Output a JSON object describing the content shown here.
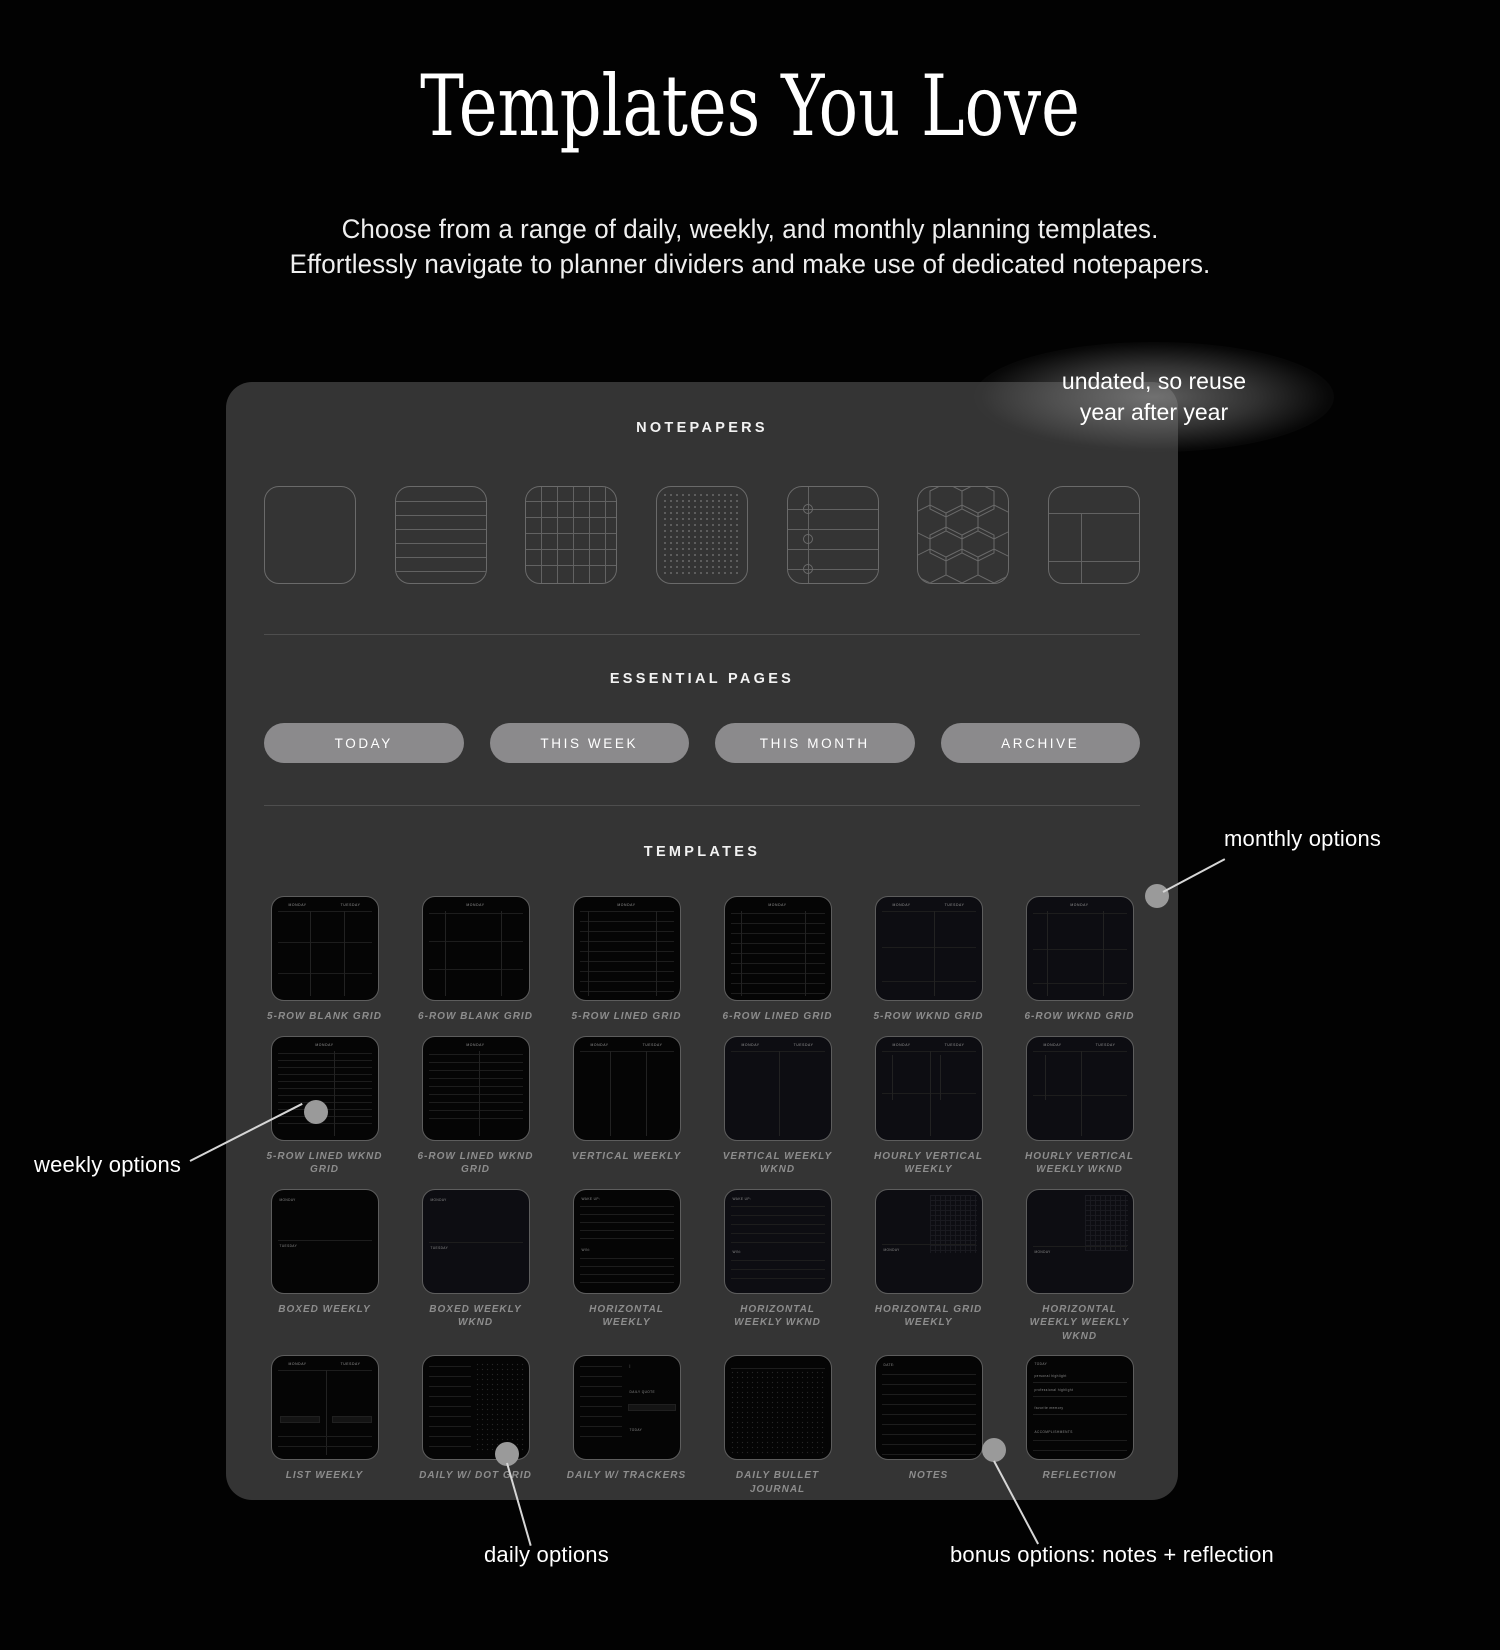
{
  "header": {
    "title": "Templates You Love",
    "subtitle_line1": "Choose from a range of daily, weekly, and monthly planning templates.",
    "subtitle_line2": "Effortlessly navigate to planner dividers and make use of dedicated notepapers."
  },
  "callouts": {
    "undated_line1": "undated, so reuse",
    "undated_line2": "year after year",
    "monthly": "monthly options",
    "weekly": "weekly options",
    "daily": "daily options",
    "bonus": "bonus options: notes + reflection"
  },
  "notepapers": {
    "heading": "NOTEPAPERS",
    "items": [
      {
        "name": "blank",
        "icon": "blank-paper-icon"
      },
      {
        "name": "lined",
        "icon": "lined-paper-icon"
      },
      {
        "name": "grid",
        "icon": "grid-paper-icon"
      },
      {
        "name": "dotted",
        "icon": "dot-grid-paper-icon"
      },
      {
        "name": "cornell",
        "icon": "cornell-paper-icon"
      },
      {
        "name": "hexagon",
        "icon": "hexagon-paper-icon"
      },
      {
        "name": "split",
        "icon": "split-paper-icon"
      }
    ]
  },
  "essential_pages": {
    "heading": "ESSENTIAL PAGES",
    "buttons": [
      "TODAY",
      "THIS WEEK",
      "THIS MONTH",
      "ARCHIVE"
    ]
  },
  "templates": {
    "heading": "TEMPLATES",
    "items": [
      {
        "label": "5-ROW BLANK GRID",
        "style": "month-blank-2col",
        "tinted": false
      },
      {
        "label": "6-ROW BLANK GRID",
        "style": "month-blank-2col",
        "tinted": false
      },
      {
        "label": "5-ROW LINED GRID",
        "style": "month-lined",
        "tinted": false
      },
      {
        "label": "6-ROW LINED GRID",
        "style": "month-lined",
        "tinted": false
      },
      {
        "label": "5-ROW WKND GRID",
        "style": "month-wknd",
        "tinted": true
      },
      {
        "label": "6-ROW WKND GRID",
        "style": "month-wknd",
        "tinted": true
      },
      {
        "label": "5-ROW LINED WKND GRID",
        "style": "month-lined-wknd",
        "tinted": false
      },
      {
        "label": "6-ROW LINED WKND GRID",
        "style": "month-lined-wknd",
        "tinted": false
      },
      {
        "label": "VERTICAL WEEKLY",
        "style": "vertical-weekly",
        "tinted": false
      },
      {
        "label": "VERTICAL WEEKLY WKND",
        "style": "vertical-weekly",
        "tinted": true
      },
      {
        "label": "HOURLY VERTICAL WEEKLY",
        "style": "hourly-vertical",
        "tinted": true
      },
      {
        "label": "HOURLY VERTICAL WEEKLY WKND",
        "style": "hourly-vertical",
        "tinted": true
      },
      {
        "label": "BOXED WEEKLY",
        "style": "boxed-weekly",
        "tinted": false
      },
      {
        "label": "BOXED WEEKLY WKND",
        "style": "boxed-weekly",
        "tinted": true
      },
      {
        "label": "HORIZONTAL WEEKLY",
        "style": "horizontal-weekly",
        "tinted": false
      },
      {
        "label": "HORIZONTAL WEEKLY WKND",
        "style": "horizontal-weekly",
        "tinted": true
      },
      {
        "label": "HORIZONTAL GRID WEEKLY",
        "style": "horizontal-grid",
        "tinted": true
      },
      {
        "label": "HORIZONTAL WEEKLY WEEKLY WKND",
        "style": "horizontal-grid",
        "tinted": true
      },
      {
        "label": "LIST WEEKLY",
        "style": "list-weekly",
        "tinted": false
      },
      {
        "label": "DAILY W/ DOT GRID",
        "style": "daily-dot",
        "tinted": false
      },
      {
        "label": "DAILY W/ TRACKERS",
        "style": "daily-trackers",
        "tinted": false
      },
      {
        "label": "DAILY BULLET JOURNAL",
        "style": "daily-bullet",
        "tinted": false
      },
      {
        "label": "NOTES",
        "style": "notes",
        "tinted": false
      },
      {
        "label": "REFLECTION",
        "style": "reflection",
        "tinted": false
      }
    ],
    "mini_text": {
      "monday": "MONDAY",
      "tuesday": "TUESDAY",
      "wake_up": "WAKE UP:",
      "win": "WIN:",
      "date": "DATE:",
      "today": "TODAY",
      "priorities": "PRIORITIES",
      "personal_highlight": "personal highlight",
      "professional_highlight": "professional highlight",
      "favorite_memory": "favorite memory",
      "accomplishments": "ACCOMPLISHMENTS",
      "daily_quote": "DAILY QUOTE"
    }
  },
  "colors": {
    "background": "#020202",
    "panel": "#343434",
    "pill": "#8b8a8c",
    "label": "#8d8d8d",
    "accent": "#9a9a9a"
  }
}
